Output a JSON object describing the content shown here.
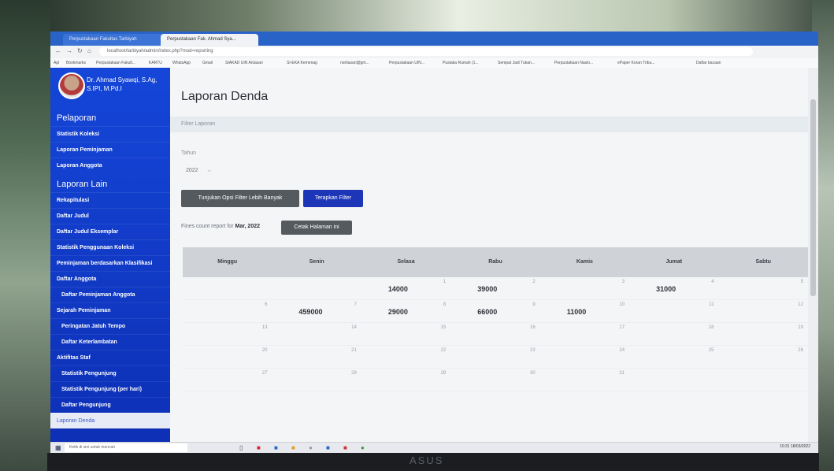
{
  "browser": {
    "tabs": [
      "Perpustakaan Fakultas Tarbiyah",
      "Perpustakaan Fak. Ahmad Sya..."
    ],
    "url": "localhost/tarbiyah/admin/index.php?mod=reporting",
    "bookmarks": [
      "Apl",
      "Bookmarks",
      "Perpustakaan Fakult...",
      "KARTU",
      "WhatsApp",
      "Gmail",
      "SIAKAD UIN Antasari",
      "SI-EKA Kemenag",
      "noritasari@gm...",
      "Perpustakaan UIN...",
      "Pustaka Rumah (1...",
      "Sempat Jadi Tukan...",
      "Perpustakaan Nasio...",
      "ePaper Koran Tribu...",
      "Daftar bacaan"
    ]
  },
  "sidebar": {
    "profile_name": "Dr. Ahmad Syawqi, S.Ag, S.IPI, M.Pd.I",
    "section1": "Pelaporan",
    "items1": [
      "Statistik Koleksi",
      "Laporan Peminjaman",
      "Laporan Anggota"
    ],
    "section2": "Laporan Lain",
    "items2": [
      "Rekapitulasi",
      "Daftar Judul",
      "Daftar Judul Eksemplar",
      "Statistik Penggunaan Koleksi",
      "Peminjaman berdasarkan Klasifikasi",
      "Daftar Anggota",
      "Daftar Peminjaman Anggota",
      "Sejarah Peminjaman",
      "Peringatan Jatuh Tempo",
      "Daftar Keterlambatan",
      "Aktifitas Staf",
      "Statistik Pengunjung",
      "Statistik Pengunjung (per hari)",
      "Daftar Pengunjung",
      "Laporan Denda"
    ]
  },
  "main": {
    "title": "Laporan Denda",
    "filter_label": "Filter Laporan",
    "year_label": "Tahun",
    "year_value": "2022",
    "btn_more": "Tunjukan Opsi Filter Lebih Banyak",
    "btn_apply": "Terapkan Filter",
    "report_prefix": "Fines count report for",
    "report_month": "Mar, 2022",
    "btn_print": "Cetak Halaman ini"
  },
  "calendar": {
    "days": [
      "Minggu",
      "Senin",
      "Selasa",
      "Rabu",
      "Kamis",
      "Jumat",
      "Sabtu"
    ],
    "weeks": [
      [
        {
          "d": "",
          "v": ""
        },
        {
          "d": "",
          "v": ""
        },
        {
          "d": "1",
          "v": "14000"
        },
        {
          "d": "2",
          "v": "39000"
        },
        {
          "d": "3",
          "v": ""
        },
        {
          "d": "4",
          "v": "31000"
        },
        {
          "d": "5",
          "v": ""
        }
      ],
      [
        {
          "d": "6",
          "v": ""
        },
        {
          "d": "7",
          "v": "459000"
        },
        {
          "d": "8",
          "v": "29000"
        },
        {
          "d": "9",
          "v": "66000"
        },
        {
          "d": "10",
          "v": "11000"
        },
        {
          "d": "11",
          "v": ""
        },
        {
          "d": "12",
          "v": ""
        }
      ],
      [
        {
          "d": "13",
          "v": ""
        },
        {
          "d": "14",
          "v": ""
        },
        {
          "d": "15",
          "v": ""
        },
        {
          "d": "16",
          "v": ""
        },
        {
          "d": "17",
          "v": ""
        },
        {
          "d": "18",
          "v": ""
        },
        {
          "d": "19",
          "v": ""
        }
      ],
      [
        {
          "d": "20",
          "v": ""
        },
        {
          "d": "21",
          "v": ""
        },
        {
          "d": "22",
          "v": ""
        },
        {
          "d": "23",
          "v": ""
        },
        {
          "d": "24",
          "v": ""
        },
        {
          "d": "25",
          "v": ""
        },
        {
          "d": "26",
          "v": ""
        }
      ],
      [
        {
          "d": "27",
          "v": ""
        },
        {
          "d": "28",
          "v": ""
        },
        {
          "d": "29",
          "v": ""
        },
        {
          "d": "30",
          "v": ""
        },
        {
          "d": "31",
          "v": ""
        },
        {
          "d": "",
          "v": ""
        },
        {
          "d": "",
          "v": ""
        }
      ]
    ]
  },
  "taskbar": {
    "search_placeholder": "Ketik di sini untuk mencari",
    "time": "10:31",
    "date": "18/03/2022"
  },
  "monitor_brand": "ASUS"
}
